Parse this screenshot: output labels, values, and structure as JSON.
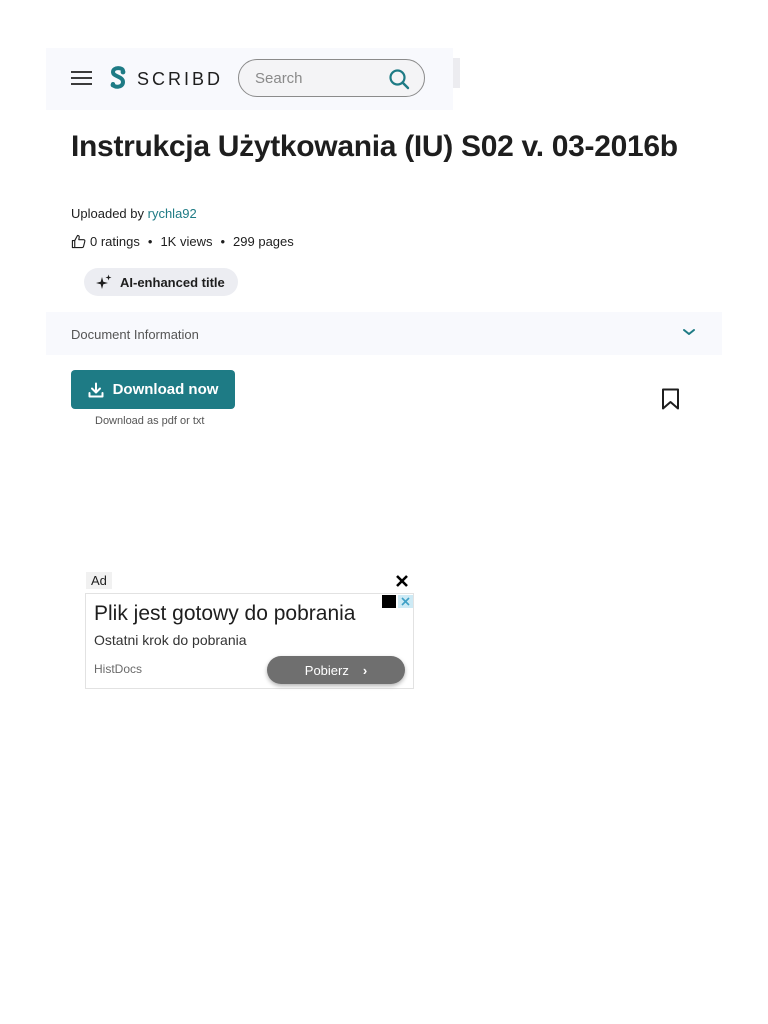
{
  "colors": {
    "brand": "#1e7b85",
    "header_bg": "#f8f9fd",
    "title_text": "#1e1e1e"
  },
  "header": {
    "menu_icon": "hamburger-icon",
    "logo_text": "SCRIBD",
    "search": {
      "placeholder": "Search",
      "icon": "search-icon"
    }
  },
  "document": {
    "title": "Instrukcja Użytkowania (IU) S02 v. 03-2016b",
    "uploaded_prefix": "Uploaded by",
    "uploader": "rychla92",
    "ratings": "0 ratings",
    "views": "1K views",
    "pages": "299 pages",
    "ai_badge": "AI-enhanced title"
  },
  "doc_info": {
    "label": "Document Information"
  },
  "actions": {
    "download_label": "Download now",
    "download_sub": "Download as pdf or txt",
    "bookmark_icon": "bookmark-icon"
  },
  "ad": {
    "label": "Ad",
    "headline": "Plik jest gotowy do pobrania",
    "subline": "Ostatni krok do pobrania",
    "brand": "HistDocs",
    "cta": "Pobierz"
  }
}
